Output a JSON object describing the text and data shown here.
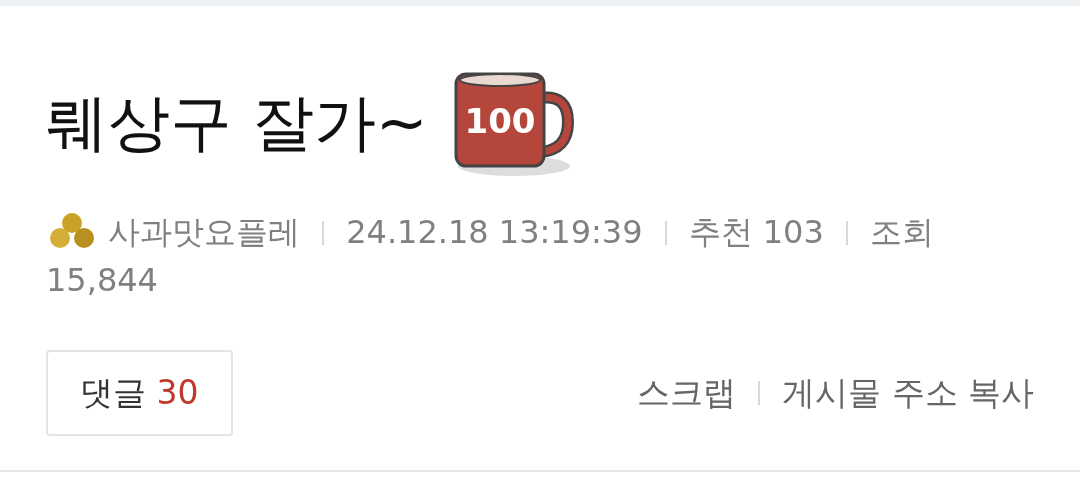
{
  "post": {
    "title": "뤠상구 잘가~",
    "mug_badge": "100"
  },
  "meta": {
    "author": "사과맛요플레",
    "date": "24.12.18 13:19:39",
    "recommend_label": "추천",
    "recommend_count": "103",
    "views_label": "조회",
    "views_count": "15,844"
  },
  "comments_button": {
    "label": "댓글",
    "count": "30"
  },
  "actions": [
    "스크랩",
    "게시물 주소 복사"
  ]
}
